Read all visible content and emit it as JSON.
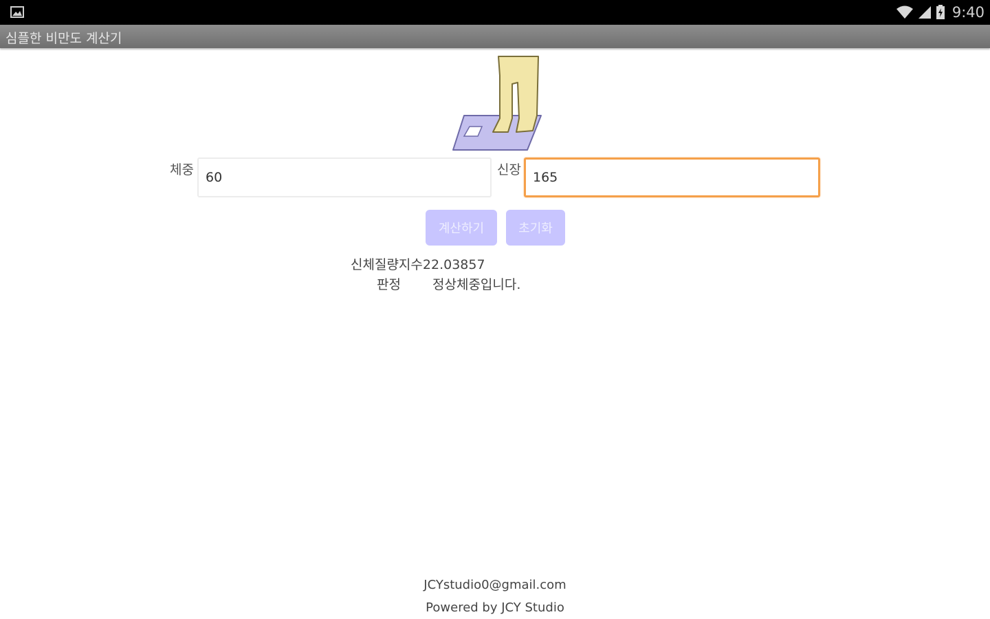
{
  "status_bar": {
    "left_icon": "gallery-notification-icon",
    "icons": [
      "wifi-icon",
      "signal-icon",
      "battery-icon"
    ],
    "time": "9:40"
  },
  "app": {
    "title": "심플한 비만도 계산기"
  },
  "illustration": {
    "icon": "person-on-scale-icon"
  },
  "form": {
    "weight_label": "체중",
    "weight_value": "60",
    "height_label": "신장",
    "height_value": "165"
  },
  "buttons": {
    "calculate": "계산하기",
    "reset": "초기화"
  },
  "result": {
    "bmi_label": "신체질량지수",
    "bmi_value": "22.03857",
    "verdict_label": "판정",
    "verdict_value": "정상체중입니다."
  },
  "footer": {
    "email": "JCYstudio0@gmail.com",
    "powered_by": "Powered by JCY Studio"
  },
  "colors": {
    "status_bar": "#000000",
    "title_bar": "#7f7f7f",
    "button_bg": "#c8c5ff",
    "focus_border": "#f5a04a",
    "scale_fill": "#c4c0ee",
    "legs_fill": "#f2e6a8"
  }
}
